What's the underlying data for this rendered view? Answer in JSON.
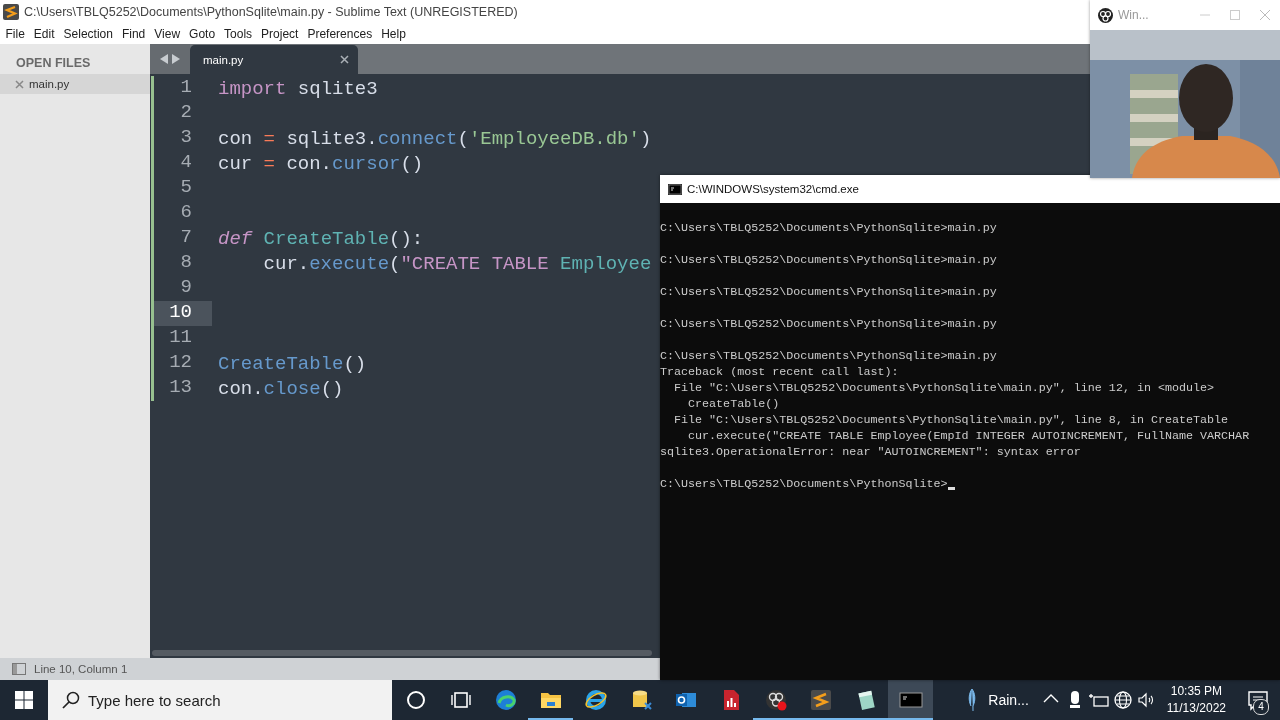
{
  "editor_window": {
    "title": "C:\\Users\\TBLQ5252\\Documents\\PythonSqlite\\main.py - Sublime Text (UNREGISTERED)",
    "menu": [
      "File",
      "Edit",
      "Selection",
      "Find",
      "View",
      "Goto",
      "Tools",
      "Project",
      "Preferences",
      "Help"
    ],
    "sidebar": {
      "heading": "OPEN FILES",
      "files": [
        {
          "name": "main.py",
          "selected": true
        }
      ]
    },
    "tabs": [
      {
        "label": "main.py",
        "selected": true
      }
    ],
    "code": [
      {
        "number": "1",
        "current": false,
        "tokens": [
          {
            "text": "import",
            "kind": "keyword"
          },
          {
            "text": " sqlite3",
            "kind": "plain"
          }
        ]
      },
      {
        "number": "2",
        "current": false
      },
      {
        "number": "3",
        "current": false,
        "tokens": [
          {
            "text": "con ",
            "kind": "plain"
          },
          {
            "text": "=",
            "kind": "operator"
          },
          {
            "text": " sqlite3.",
            "kind": "plain"
          },
          {
            "text": "connect",
            "kind": "call"
          },
          {
            "text": "(",
            "kind": "plain"
          },
          {
            "text": "'EmployeeDB.db'",
            "kind": "string"
          },
          {
            "text": ")",
            "kind": "plain"
          }
        ]
      },
      {
        "number": "4",
        "current": false,
        "tokens": [
          {
            "text": "cur ",
            "kind": "plain"
          },
          {
            "text": "=",
            "kind": "operator"
          },
          {
            "text": " con.",
            "kind": "plain"
          },
          {
            "text": "cursor",
            "kind": "call"
          },
          {
            "text": "()",
            "kind": "plain"
          }
        ]
      },
      {
        "number": "5",
        "current": false
      },
      {
        "number": "6",
        "current": false
      },
      {
        "number": "7",
        "current": false,
        "tokens": [
          {
            "text": "def",
            "kind": "storage"
          },
          {
            "text": " CreateTable",
            "kind": "entity"
          },
          {
            "text": "():",
            "kind": "plain"
          }
        ]
      },
      {
        "number": "8",
        "current": false,
        "tokens": [
          {
            "text": "    cur.",
            "kind": "plain"
          },
          {
            "text": "execute",
            "kind": "call"
          },
          {
            "text": "(",
            "kind": "plain"
          },
          {
            "text": "\"CREATE TABLE",
            "kind": "sqlkw"
          },
          {
            "text": " Employee",
            "kind": "entity"
          }
        ]
      },
      {
        "number": "9",
        "current": false
      },
      {
        "number": "10",
        "current": true
      },
      {
        "number": "11",
        "current": false
      },
      {
        "number": "12",
        "current": false,
        "tokens": [
          {
            "text": "CreateTable",
            "kind": "call"
          },
          {
            "text": "()",
            "kind": "plain"
          }
        ]
      },
      {
        "number": "13",
        "current": false,
        "tokens": [
          {
            "text": "con.",
            "kind": "plain"
          },
          {
            "text": "close",
            "kind": "call"
          },
          {
            "text": "()",
            "kind": "plain"
          }
        ]
      }
    ],
    "status_bar": "Line 10, Column 1"
  },
  "console_window": {
    "title": "C:\\WINDOWS\\system32\\cmd.exe",
    "blocks": [
      [
        "C:\\Users\\TBLQ5252\\Documents\\PythonSqlite>main.py"
      ],
      [
        "C:\\Users\\TBLQ5252\\Documents\\PythonSqlite>main.py"
      ],
      [
        "C:\\Users\\TBLQ5252\\Documents\\PythonSqlite>main.py"
      ],
      [
        "C:\\Users\\TBLQ5252\\Documents\\PythonSqlite>main.py"
      ],
      [
        "C:\\Users\\TBLQ5252\\Documents\\PythonSqlite>main.py",
        "Traceback (most recent call last):",
        "  File \"C:\\Users\\TBLQ5252\\Documents\\PythonSqlite\\main.py\", line 12, in <module>",
        "    CreateTable()",
        "  File \"C:\\Users\\TBLQ5252\\Documents\\PythonSqlite\\main.py\", line 8, in CreateTable",
        "    cur.execute(\"CREATE TABLE Employee(EmpId INTEGER AUTOINCREMENT, FullName VARCHAR",
        "sqlite3.OperationalError: near \"AUTOINCREMENT\": syntax error"
      ],
      [
        "C:\\Users\\TBLQ5252\\Documents\\PythonSqlite>"
      ]
    ],
    "cursor": true
  },
  "camera_window": {
    "title": "Win..."
  },
  "taskbar": {
    "search": {
      "placeholder": "Type here to search"
    },
    "apps": [
      {
        "kind": "cortana",
        "running": false,
        "selected": false
      },
      {
        "kind": "taskview",
        "running": false,
        "selected": false
      },
      {
        "kind": "edge",
        "running": false,
        "selected": false
      },
      {
        "kind": "folder",
        "running": true,
        "selected": false
      },
      {
        "kind": "ie",
        "running": false,
        "selected": false
      },
      {
        "kind": "database",
        "running": false,
        "selected": false
      },
      {
        "kind": "outlook",
        "running": false,
        "selected": false
      },
      {
        "kind": "report",
        "running": false,
        "selected": false
      },
      {
        "kind": "obs",
        "running": true,
        "selected": false
      },
      {
        "kind": "sublime",
        "running": true,
        "selected": false
      },
      {
        "kind": "notepad",
        "running": true,
        "selected": false
      },
      {
        "kind": "console",
        "running": true,
        "selected": true
      }
    ],
    "tray": {
      "weather": "Rain...",
      "time": "10:35 PM",
      "date": "11/13/2022",
      "notifications": "4"
    }
  }
}
